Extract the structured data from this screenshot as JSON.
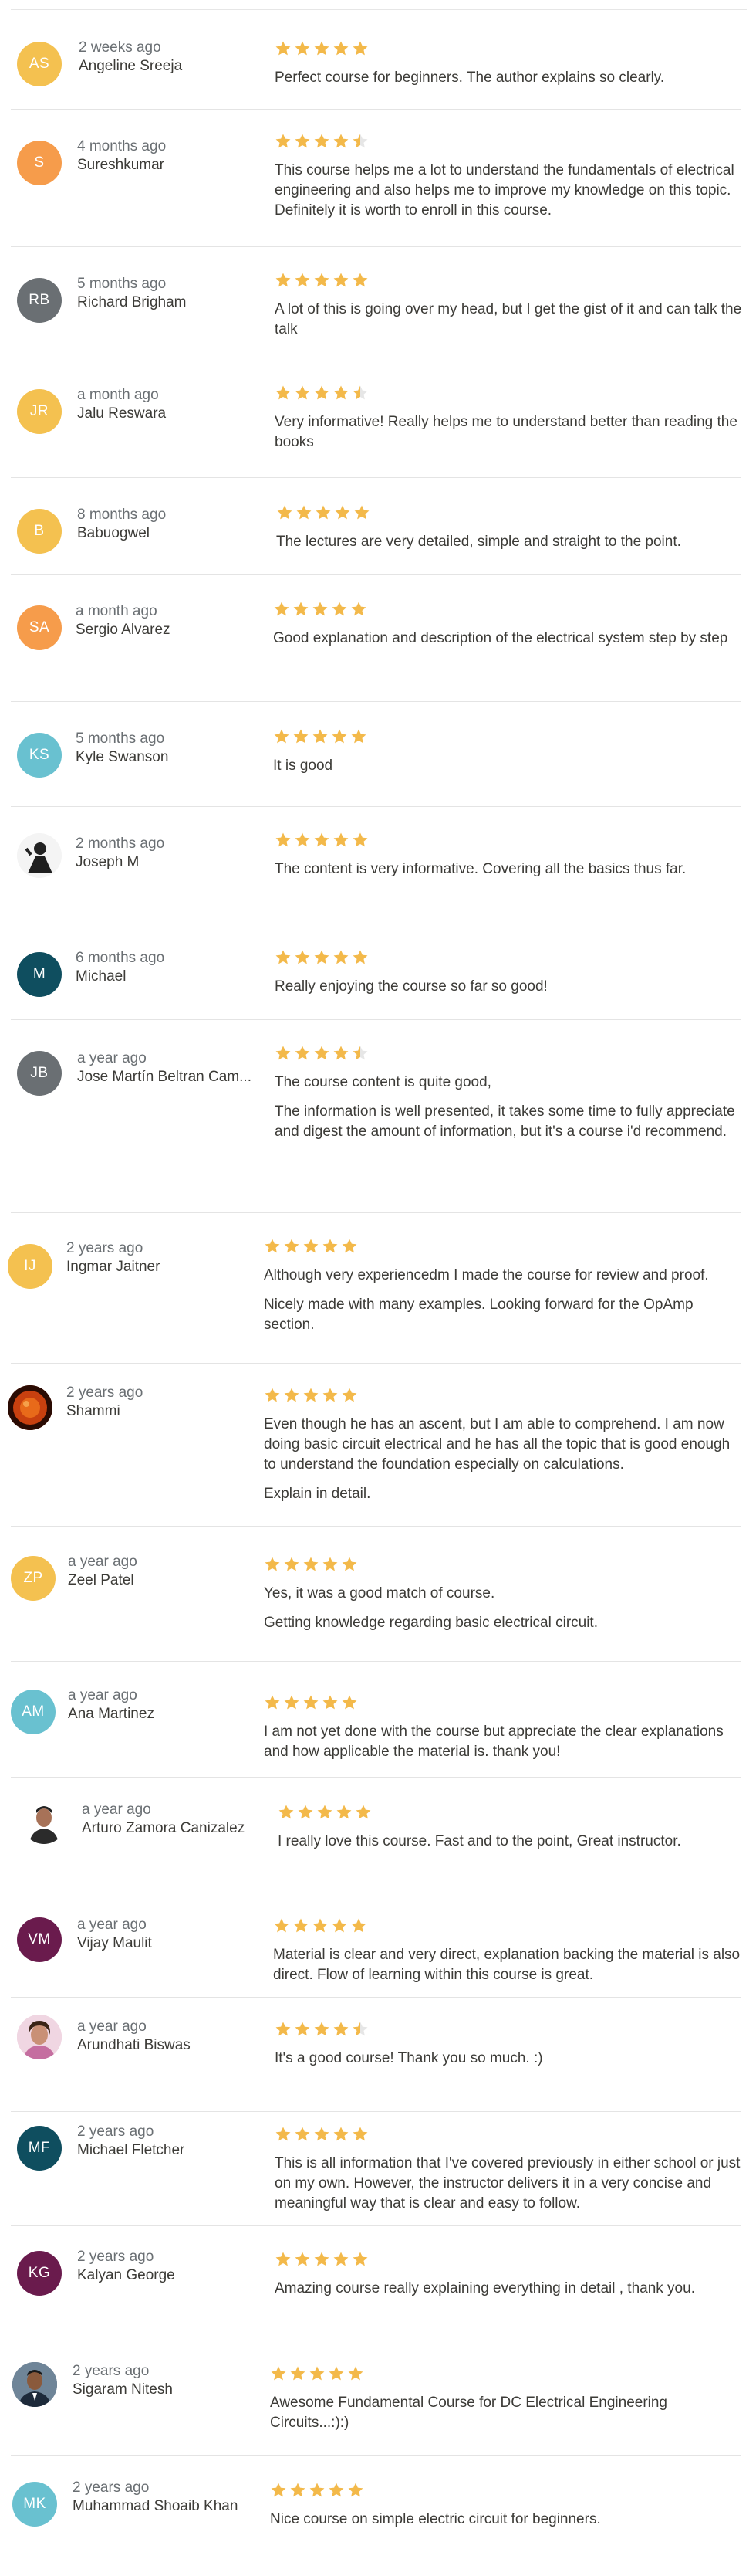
{
  "colors": {
    "star": "#f3b94a",
    "star_empty": "#e6e6e6"
  },
  "reviews": [
    {
      "initials": "AS",
      "avatar_color": "#f4c150",
      "when": "2 weeks ago",
      "name": "Angeline Sreeja",
      "rating": 5,
      "text": [
        "Perfect course for beginners. The author explains so clearly."
      ]
    },
    {
      "initials": "S",
      "avatar_color": "#f69c4b",
      "when": "4 months ago",
      "name": "Sureshkumar",
      "rating": 4.5,
      "text": [
        "This course helps me a lot to understand the fundamentals of electrical engineering and also helps me to improve my knowledge on this topic. Definitely it is worth to enroll in this course."
      ]
    },
    {
      "initials": "RB",
      "avatar_color": "#6a6f73",
      "when": "5 months ago",
      "name": "Richard Brigham",
      "rating": 5,
      "text": [
        "A lot of this is going over my head, but I get the gist of it and can talk the talk"
      ]
    },
    {
      "initials": "JR",
      "avatar_color": "#f4c150",
      "when": "a month ago",
      "name": "Jalu Reswara",
      "rating": 4.5,
      "text": [
        "Very informative! Really helps me to understand better than reading the books"
      ]
    },
    {
      "initials": "B",
      "avatar_color": "#f4c150",
      "when": "8 months ago",
      "name": "Babuogwel",
      "rating": 5,
      "text": [
        "The lectures are very detailed, simple and straight to the point."
      ]
    },
    {
      "initials": "SA",
      "avatar_color": "#f69c4b",
      "when": "a month ago",
      "name": "Sergio Alvarez",
      "rating": 5,
      "text": [
        "Good explanation and description of the electrical system step by step"
      ]
    },
    {
      "initials": "KS",
      "avatar_color": "#69c1d0",
      "when": "5 months ago",
      "name": "Kyle Swanson",
      "rating": 5,
      "text": [
        "It is good"
      ]
    },
    {
      "initials": "",
      "avatar_icon": "person-photo",
      "avatar_color": "#ffffff",
      "when": "2 months ago",
      "name": "Joseph M",
      "rating": 5,
      "text": [
        "The content is very informative. Covering all the basics thus far."
      ]
    },
    {
      "initials": "M",
      "avatar_color": "#0f4e5f",
      "when": "6 months ago",
      "name": "Michael",
      "rating": 5,
      "text": [
        "Really enjoying the course so far so good!"
      ]
    },
    {
      "initials": "JB",
      "avatar_color": "#6a6f73",
      "when": "a year ago",
      "name": "Jose Martín Beltran Cam...",
      "rating": 4.5,
      "text": [
        "The course content is quite good,",
        "The information is well presented, it takes some time to fully appreciate and digest the amount of information, but it's a course i'd recommend."
      ]
    },
    {
      "initials": "IJ",
      "avatar_color": "#f4c150",
      "when": "2 years ago",
      "name": "Ingmar Jaitner",
      "rating": 5,
      "text": [
        "Although very experiencedm I made the course for review and proof.",
        "Nicely made with many examples. Looking forward for the OpAmp section."
      ]
    },
    {
      "initials": "",
      "avatar_icon": "sun-photo",
      "avatar_color": "#b1340d",
      "when": "2 years ago",
      "name": "Shammi",
      "rating": 5,
      "text": [
        "Even though he has an ascent, but I am able to comprehend. I am now doing basic circuit electrical and he has all the topic that is good enough to understand the foundation especially on calculations.",
        "Explain in detail."
      ]
    },
    {
      "initials": "ZP",
      "avatar_color": "#f4c150",
      "when": "a year ago",
      "name": "Zeel Patel",
      "rating": 5,
      "text": [
        "Yes, it was a good match of course.",
        "Getting knowledge regarding basic electrical circuit."
      ]
    },
    {
      "initials": "AM",
      "avatar_color": "#69c1d0",
      "when": "a year ago",
      "name": "Ana Martinez",
      "rating": 5,
      "text": [
        "I am not yet done with the course but appreciate the clear explanations and how applicable the material is. thank you!"
      ]
    },
    {
      "initials": "",
      "avatar_icon": "man-photo",
      "avatar_color": "#ffffff",
      "when": "a year ago",
      "name": "Arturo Zamora Canizalez",
      "rating": 5,
      "text": [
        "I really love this course. Fast and to the point, Great instructor."
      ]
    },
    {
      "initials": "VM",
      "avatar_color": "#6a1b4d",
      "when": "a year ago",
      "name": "Vijay Maulit",
      "rating": 5,
      "text": [
        "Material is clear and very direct, explanation backing the material is also direct. Flow of learning within this course is great."
      ]
    },
    {
      "initials": "",
      "avatar_icon": "woman-photo",
      "avatar_color": "#e8c6d6",
      "when": "a year ago",
      "name": "Arundhati Biswas",
      "rating": 4.5,
      "text": [
        "It's a good course! Thank you so much. :)"
      ]
    },
    {
      "initials": "MF",
      "avatar_color": "#0f4e5f",
      "when": "2 years ago",
      "name": "Michael Fletcher",
      "rating": 5,
      "text": [
        "This is all information that I've covered previously in either school or just on my own. However, the instructor delivers it in a very concise and meaningful way that is clear and easy to follow."
      ]
    },
    {
      "initials": "KG",
      "avatar_color": "#6a1b4d",
      "when": "2 years ago",
      "name": "Kalyan George",
      "rating": 5,
      "text": [
        "Amazing course really explaining everything in detail , thank you."
      ]
    },
    {
      "initials": "",
      "avatar_icon": "man-suit-photo",
      "avatar_color": "#5a6b7c",
      "when": "2 years ago",
      "name": "Sigaram Nitesh",
      "rating": 5,
      "text": [
        "Awesome Fundamental Course for DC Electrical Engineering Circuits...:):)"
      ]
    },
    {
      "initials": "MK",
      "avatar_color": "#69c1d0",
      "when": "2 years ago",
      "name": "Muhammad Shoaib Khan",
      "rating": 5,
      "text": [
        "Nice course on simple electric circuit for beginners."
      ]
    }
  ]
}
